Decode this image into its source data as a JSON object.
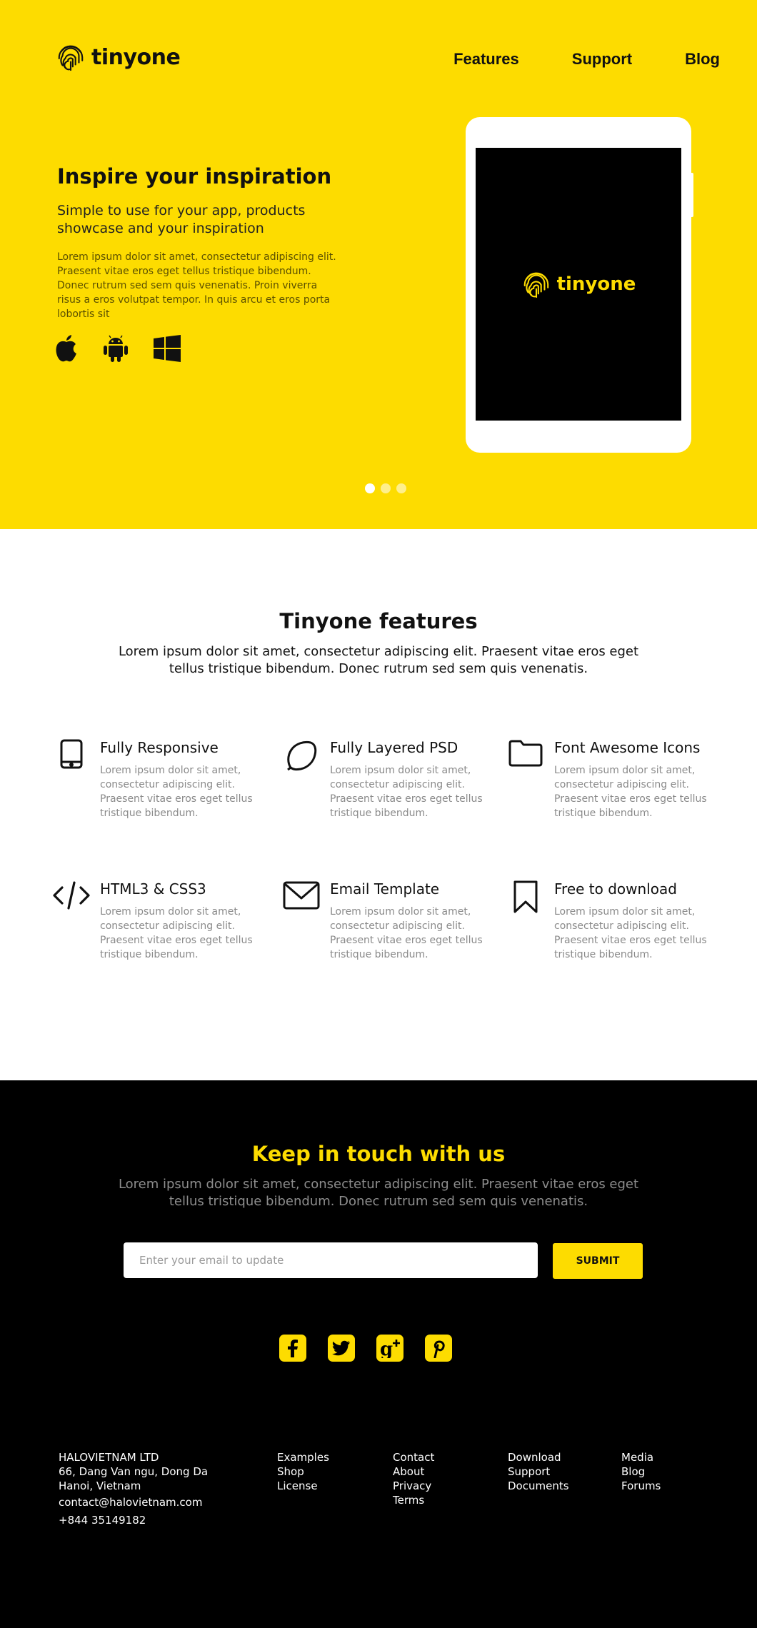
{
  "brand": {
    "name": "tinyone",
    "accent": "#FDDC00"
  },
  "nav": {
    "items": [
      "Features",
      "Support",
      "Blog"
    ]
  },
  "hero": {
    "title": "Inspire your inspiration",
    "subtitle": "Simple to use for your app, products showcase and your inspiration",
    "body": "Lorem ipsum dolor sit amet, consectetur adipiscing elit. Praesent vitae eros eget tellus tristique bibendum. Donec rutrum sed sem quis venenatis. Proin viverra risus a eros volutpat tempor. In quis arcu et eros porta lobortis sit",
    "platforms": [
      "apple-icon",
      "android-icon",
      "windows-icon"
    ],
    "device_logo": "tinyone",
    "slider": {
      "total": 3,
      "active": 1
    }
  },
  "features": {
    "title": "Tinyone features",
    "description": "Lorem ipsum dolor sit amet, consectetur adipiscing elit. Praesent vitae eros eget tellus tristique bibendum. Donec rutrum sed sem quis venenatis.",
    "items": [
      {
        "icon": "tablet-icon",
        "title": "Fully Responsive",
        "text": "Lorem ipsum dolor sit amet, consectetur adipiscing elit. Praesent vitae eros eget tellus tristique bibendum."
      },
      {
        "icon": "lemon-icon",
        "title": "Fully Layered PSD",
        "text": "Lorem ipsum dolor sit amet, consectetur adipiscing elit. Praesent vitae eros eget tellus tristique bibendum."
      },
      {
        "icon": "folder-icon",
        "title": "Font Awesome Icons",
        "text": "Lorem ipsum dolor sit amet, consectetur adipiscing elit. Praesent vitae eros eget tellus tristique bibendum."
      },
      {
        "icon": "code-icon",
        "title": "HTML3 & CSS3",
        "text": "Lorem ipsum dolor sit amet, consectetur adipiscing elit. Praesent vitae eros eget tellus tristique bibendum."
      },
      {
        "icon": "envelope-icon",
        "title": "Email Template",
        "text": "Lorem ipsum dolor sit amet, consectetur adipiscing elit. Praesent vitae eros eget tellus tristique bibendum."
      },
      {
        "icon": "bookmark-icon",
        "title": "Free to download",
        "text": "Lorem ipsum dolor sit amet, consectetur adipiscing elit. Praesent vitae eros eget tellus tristique bibendum."
      }
    ]
  },
  "contact": {
    "title": "Keep in touch with us",
    "description": "Lorem ipsum dolor sit amet, consectetur adipiscing elit. Praesent vitae eros eget tellus tristique bibendum. Donec rutrum sed sem quis venenatis.",
    "email_placeholder": "Enter your email to update",
    "submit_label": "SUBMIT",
    "socials": [
      "facebook-icon",
      "twitter-icon",
      "google-plus-icon",
      "pinterest-icon"
    ]
  },
  "footer": {
    "company": {
      "name": "HALOVIETNAM LTD",
      "address_line1": "66, Dang Van ngu, Dong Da",
      "address_line2": "Hanoi, Vietnam",
      "email": "contact@halovietnam.com",
      "phone": "+844 35149182"
    },
    "columns": [
      [
        "Examples",
        "Shop",
        "License"
      ],
      [
        "Contact",
        "About",
        "Privacy",
        "Terms"
      ],
      [
        "Download",
        "Support",
        "Documents"
      ],
      [
        "Media",
        "Blog",
        "Forums"
      ]
    ]
  }
}
